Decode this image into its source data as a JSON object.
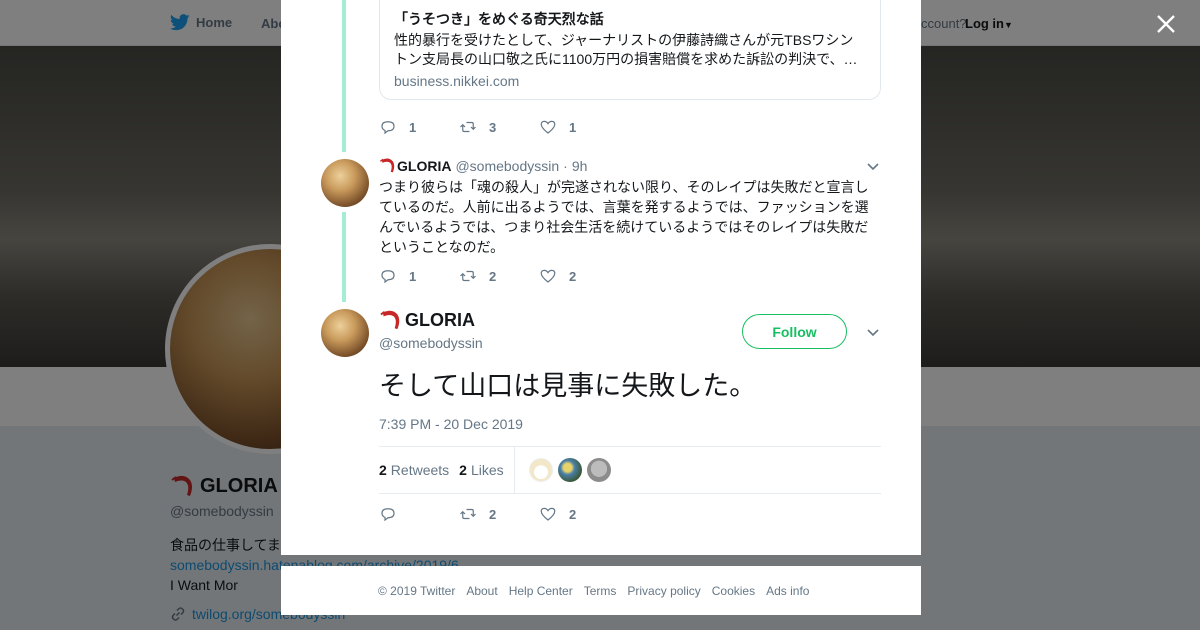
{
  "nav": {
    "home_label": "Home",
    "about_label": "Abo",
    "account_text": "ccount?",
    "login_label": "Log in"
  },
  "profile": {
    "name": "GLORIA",
    "handle": "@somebodyssin",
    "bio_text": "食品の仕事してま",
    "bio_link": "somebodyssin.hatenablog.com/archive/2019/6",
    "bio_suffix": " I Want Mor",
    "website": "twilog.org/somebodyssin"
  },
  "link_card": {
    "title": "「うそつき」をめぐる奇天烈な話",
    "description": "性的暴行を受けたとして、ジャーナリストの伊藤詩織さんが元TBSワシントン支局長の山口敬之氏に1100万円の損害賠償を求めた訴訟の判決で、…",
    "domain": "business.nikkei.com"
  },
  "tweet1_actions": {
    "replies": "1",
    "retweets": "3",
    "likes": "1"
  },
  "tweet2": {
    "name": "GLORIA",
    "handle": "@somebodyssin",
    "dot": "·",
    "time": "9h",
    "text": "つまり彼らは「魂の殺人」が完遂されない限り、そのレイプは失敗だと宣言しているのだ。人前に出るようでは、言葉を発するようでは、ファッションを選んでいるようでは、つまり社会生活を続けているようではそのレイプは失敗だということなのだ。",
    "replies": "1",
    "retweets": "2",
    "likes": "2"
  },
  "main_tweet": {
    "name": "GLORIA",
    "handle": "@somebodyssin",
    "follow_label": "Follow",
    "text": "そして山口は見事に失敗した。",
    "date": "7:39 PM - 20 Dec 2019",
    "retweet_count": "2",
    "retweet_label": "Retweets",
    "like_count": "2",
    "like_label": "Likes",
    "retweets": "2",
    "likes": "2"
  },
  "footer": {
    "items": [
      "© 2019 Twitter",
      "About",
      "Help Center",
      "Terms",
      "Privacy policy",
      "Cookies",
      "Ads info"
    ]
  },
  "colors": {
    "accent": "#1da1f2",
    "follow": "#17bf63",
    "thread": "#a5ecd7",
    "muted": "#657786"
  }
}
